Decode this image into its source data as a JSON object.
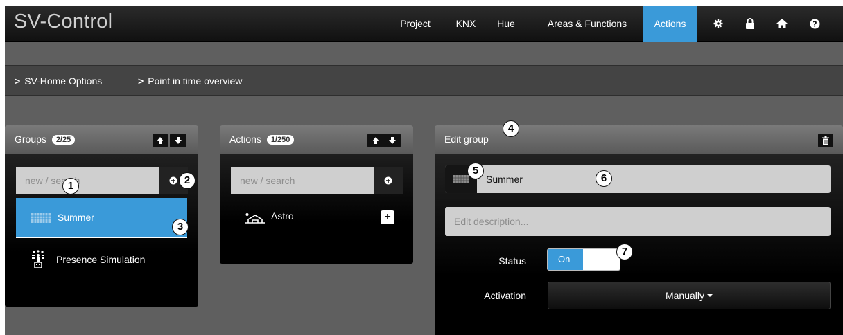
{
  "app": {
    "title": "SV-Control"
  },
  "nav": {
    "items": [
      {
        "label": "Project"
      },
      {
        "label": "KNX"
      },
      {
        "label": "Hue"
      },
      {
        "label": "Areas & Functions"
      },
      {
        "label": "Actions"
      }
    ],
    "active": "Actions",
    "icons": [
      "gear-icon",
      "lock-icon",
      "home-icon",
      "help-icon"
    ]
  },
  "breadcrumbs": [
    {
      "label": "SV-Home Options"
    },
    {
      "label": "Point in time overview"
    }
  ],
  "groups": {
    "title": "Groups",
    "badge": "2/25",
    "search_placeholder": "new / search",
    "items": [
      {
        "label": "Summer",
        "icon": "calendar-grid-icon",
        "selected": true
      },
      {
        "label": "Presence Simulation",
        "icon": "presence-people-icon",
        "selected": false
      }
    ]
  },
  "actions": {
    "title": "Actions",
    "badge": "1/250",
    "search_placeholder": "new / search",
    "items": [
      {
        "label": "Astro",
        "icon": "astro-sunrise-icon"
      }
    ]
  },
  "edit_group": {
    "title": "Edit group",
    "name_value": "Summer",
    "description_placeholder": "Edit description...",
    "status_label": "Status",
    "status_value": "On",
    "activation_label": "Activation",
    "activation_value": "Manually"
  },
  "markers": [
    "1",
    "2",
    "3",
    "4",
    "5",
    "6",
    "7"
  ],
  "colors": {
    "accent": "#3a9ad9",
    "background": "#5f5f5f",
    "navbar": "#111111"
  }
}
